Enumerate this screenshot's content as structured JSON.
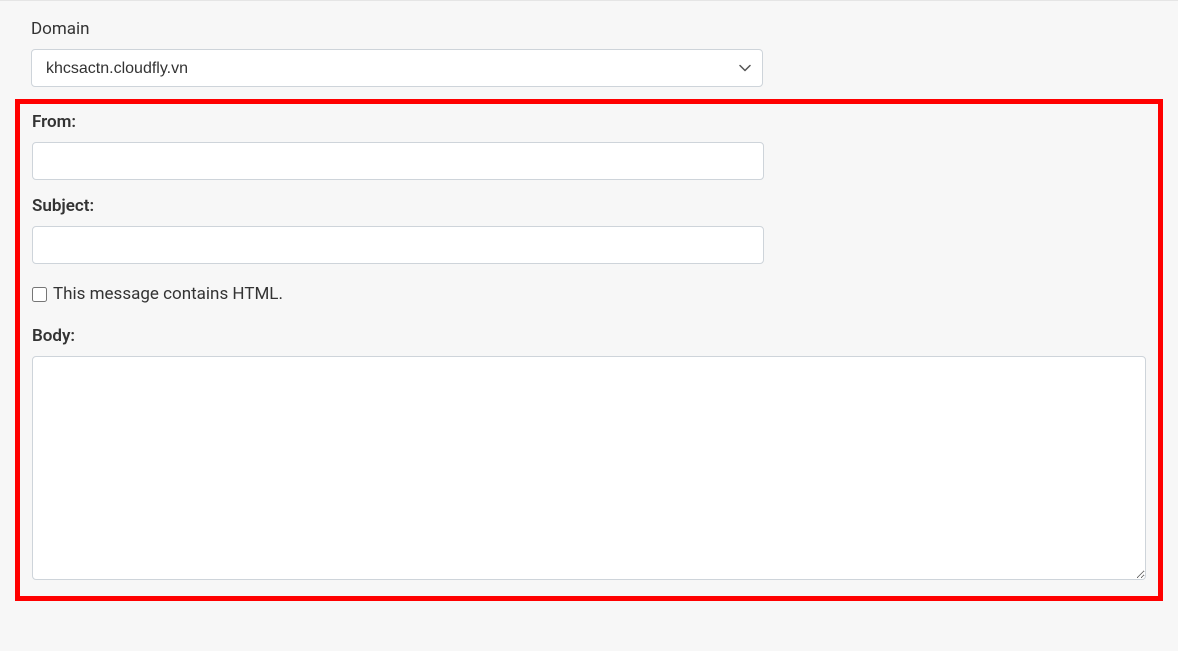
{
  "domain": {
    "label": "Domain",
    "selectedValue": "khcsactn.cloudfly.vn"
  },
  "form": {
    "fromLabel": "From:",
    "fromValue": "",
    "subjectLabel": "Subject:",
    "subjectValue": "",
    "htmlCheckbox": {
      "label": "This message contains HTML.",
      "checked": false
    },
    "bodyLabel": "Body:",
    "bodyValue": ""
  }
}
